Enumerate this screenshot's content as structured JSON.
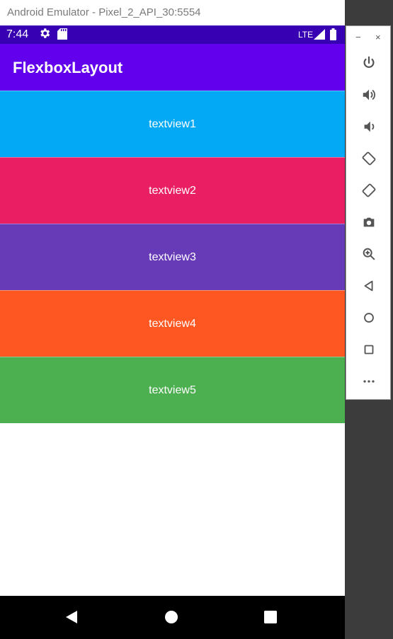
{
  "window": {
    "title": "Android Emulator - Pixel_2_API_30:5554"
  },
  "status_bar": {
    "time": "7:44",
    "network": "LTE"
  },
  "app_bar": {
    "title": "FlexboxLayout"
  },
  "textviews": [
    {
      "label": "textview1",
      "color": "#03a9f4"
    },
    {
      "label": "textview2",
      "color": "#e91e63"
    },
    {
      "label": "textview3",
      "color": "#673ab7"
    },
    {
      "label": "textview4",
      "color": "#ff5722"
    },
    {
      "label": "textview5",
      "color": "#4caf50"
    }
  ],
  "nav_bar": {
    "icons": [
      "back-icon",
      "home-icon",
      "recents-icon"
    ]
  },
  "emulator_controls": {
    "window_controls": {
      "minimize": "−",
      "close": "×"
    },
    "buttons": [
      "power-icon",
      "volume-up-icon",
      "volume-down-icon",
      "rotate-left-icon",
      "rotate-right-icon",
      "camera-icon",
      "zoom-icon",
      "back-icon",
      "home-icon",
      "overview-icon",
      "more-icon"
    ]
  },
  "colors": {
    "status_bar": "#3700b3",
    "app_bar": "#6200ee"
  }
}
